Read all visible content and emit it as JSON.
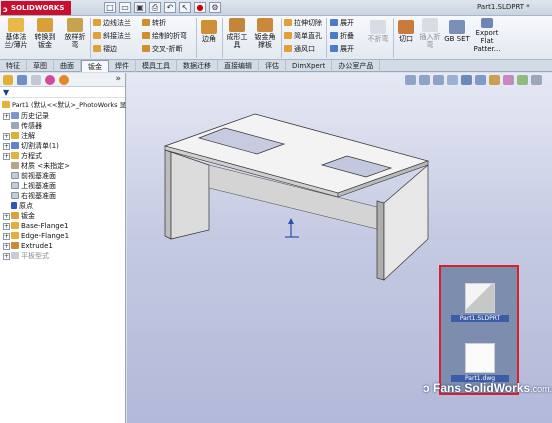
{
  "app": {
    "logo": "SOLIDWORKS",
    "window_title": "Part1.SLDPRT *"
  },
  "quick_access": [
    "new-icon",
    "open-icon",
    "save-icon",
    "print-icon",
    "undo-icon",
    "select-icon",
    "rebuild-icon",
    "options-icon"
  ],
  "ribbon": {
    "big": [
      {
        "label": "基体法\n兰/薄片"
      },
      {
        "label": "转换到\n钣金"
      },
      {
        "label": "放样折\n弯"
      },
      {
        "label": "边角"
      },
      {
        "label": "成形工\n具"
      },
      {
        "label": "钣金角\n撑板"
      },
      {
        "label": "不折弯"
      },
      {
        "label": "切口"
      },
      {
        "label": "插入折\n弯"
      },
      {
        "label": "GB SET"
      },
      {
        "label": "Export\nFlat\nPatter..."
      }
    ],
    "small": [
      {
        "label": "边线法兰"
      },
      {
        "label": "斜接法兰"
      },
      {
        "label": "褶边"
      },
      {
        "label": "转折"
      },
      {
        "label": "绘制的折弯"
      },
      {
        "label": "交叉-折断"
      },
      {
        "label": "拉伸切除"
      },
      {
        "label": "简单直孔"
      },
      {
        "label": "通风口"
      },
      {
        "label": "展开"
      },
      {
        "label": "折叠"
      },
      {
        "label": "展开"
      }
    ]
  },
  "tabs": [
    "特征",
    "草图",
    "曲面",
    "钣金",
    "焊件",
    "模具工具",
    "数据迁移",
    "直接编辑",
    "评估",
    "DimXpert",
    "办公室产品"
  ],
  "active_tab": "钣金",
  "tree": {
    "root": "Part1 (默认<<默认>_PhotoWorks 显",
    "items": [
      {
        "label": "历史记录",
        "exp": "+"
      },
      {
        "label": "传感器",
        "exp": ""
      },
      {
        "label": "注解",
        "exp": "+"
      },
      {
        "label": "切割清单(1)",
        "exp": "+"
      },
      {
        "label": "方程式",
        "exp": "+"
      },
      {
        "label": "材质 <未指定>",
        "exp": ""
      },
      {
        "label": "前视基准面",
        "exp": ""
      },
      {
        "label": "上视基准面",
        "exp": ""
      },
      {
        "label": "右视基准面",
        "exp": ""
      },
      {
        "label": "原点",
        "exp": ""
      },
      {
        "label": "钣金",
        "exp": "+"
      },
      {
        "label": "Base-Flange1",
        "exp": "+"
      },
      {
        "label": "Edge-Flange1",
        "exp": "+"
      },
      {
        "label": "Extrude1",
        "exp": "+"
      },
      {
        "label": "平板型式",
        "exp": "+"
      }
    ]
  },
  "desktop_files": [
    {
      "label": "Part1.SLDPRT"
    },
    {
      "label": "Part1.dwg"
    }
  ],
  "watermark": {
    "brand": "Fans SolidWorks",
    "suffix": ".com.cn"
  },
  "colors": {
    "highlight_box": "#d7202a",
    "logo_red": "#c8102e"
  }
}
